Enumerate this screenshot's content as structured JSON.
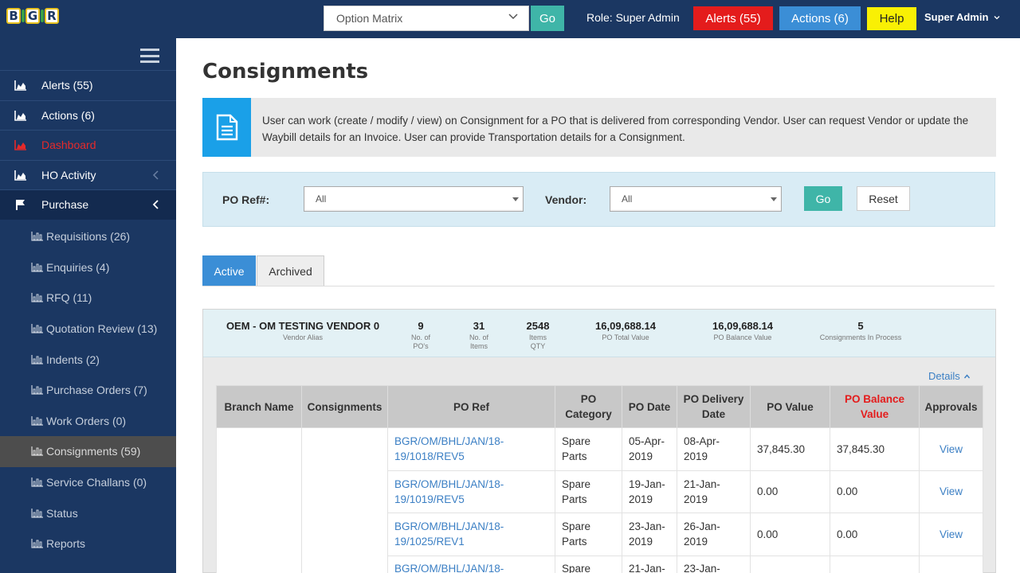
{
  "topbar": {
    "logo_letters": [
      "B",
      "G",
      "R"
    ],
    "option_select": "Option Matrix",
    "go_label": "Go",
    "role": "Role: Super Admin",
    "alerts_label": "Alerts (55)",
    "actions_label": "Actions (6)",
    "help_label": "Help",
    "user_label": "Super Admin",
    "colors": {
      "bar": "#1b3762",
      "alerts": "#e41c1c",
      "actions": "#3b8ed6",
      "help": "#f9f004",
      "go": "#3fb5a8"
    }
  },
  "sidebar": {
    "items": [
      {
        "label": "Alerts (55)",
        "icon": "area-chart-icon"
      },
      {
        "label": "Actions (6)",
        "icon": "area-chart-icon"
      },
      {
        "label": "Dashboard",
        "icon": "area-chart-icon"
      },
      {
        "label": "HO Activity",
        "icon": "area-chart-icon"
      },
      {
        "label": "Purchase",
        "icon": "flag-icon"
      }
    ],
    "sub_items": [
      {
        "label": "Requisitions (26)"
      },
      {
        "label": "Enquiries (4)"
      },
      {
        "label": "RFQ (11)"
      },
      {
        "label": "Quotation Review (13)"
      },
      {
        "label": "Indents (2)"
      },
      {
        "label": "Purchase Orders (7)"
      },
      {
        "label": "Work Orders (0)"
      },
      {
        "label": "Consignments (59)"
      },
      {
        "label": "Service Challans (0)"
      },
      {
        "label": "Status"
      },
      {
        "label": "Reports"
      }
    ]
  },
  "main": {
    "title": "Consignments",
    "info": "User can work (create / modify / view) on Consignment for a PO that is delivered from corresponding Vendor. User can request Vendor or update the Waybill details for an Invoice. User can provide Transportation details for a Consignment.",
    "filters": {
      "po_ref_label": "PO Ref#:",
      "po_ref_value": "All",
      "vendor_label": "Vendor:",
      "vendor_value": "All",
      "go_label": "Go",
      "reset_label": "Reset"
    },
    "tabs": [
      {
        "label": "Active"
      },
      {
        "label": "Archived"
      }
    ],
    "vendor": {
      "name": "OEM - OM TESTING VENDOR 0",
      "alias_label": "Vendor Alias",
      "stats": [
        {
          "value": "9",
          "label": "No. of PO's"
        },
        {
          "value": "31",
          "label": "No. of Items"
        },
        {
          "value": "2548",
          "label": "Items QTY"
        },
        {
          "value": "16,09,688.14",
          "label": "PO Total Value"
        },
        {
          "value": "16,09,688.14",
          "label": "PO Balance Value"
        },
        {
          "value": "5",
          "label": "Consignments In Process"
        }
      ],
      "details_label": "Details"
    },
    "table": {
      "headers": [
        "Branch Name",
        "Consignments",
        "PO Ref",
        "PO Category",
        "PO Date",
        "PO Delivery Date",
        "PO Value",
        "PO Balance Value",
        "Approvals"
      ],
      "rows": [
        {
          "po_ref": "BGR/OM/BHL/JAN/18-19/1018/REV5",
          "category": "Spare Parts",
          "po_date": "05-Apr-2019",
          "delivery": "08-Apr-2019",
          "value": "37,845.30",
          "balance": "37,845.30",
          "approval": "View"
        },
        {
          "po_ref": "BGR/OM/BHL/JAN/18-19/1019/REV5",
          "category": "Spare Parts",
          "po_date": "19-Jan-2019",
          "delivery": "21-Jan-2019",
          "value": "0.00",
          "balance": "0.00",
          "approval": "View"
        },
        {
          "po_ref": "BGR/OM/BHL/JAN/18-19/1025/REV1",
          "category": "Spare Parts",
          "po_date": "23-Jan-2019",
          "delivery": "26-Jan-2019",
          "value": "0.00",
          "balance": "0.00",
          "approval": "View"
        },
        {
          "po_ref": "BGR/OM/BHL/JAN/18-",
          "category": "Spare",
          "po_date": "21-Jan-",
          "delivery": "23-Jan-",
          "value": "",
          "balance": "",
          "approval": ""
        }
      ]
    }
  }
}
